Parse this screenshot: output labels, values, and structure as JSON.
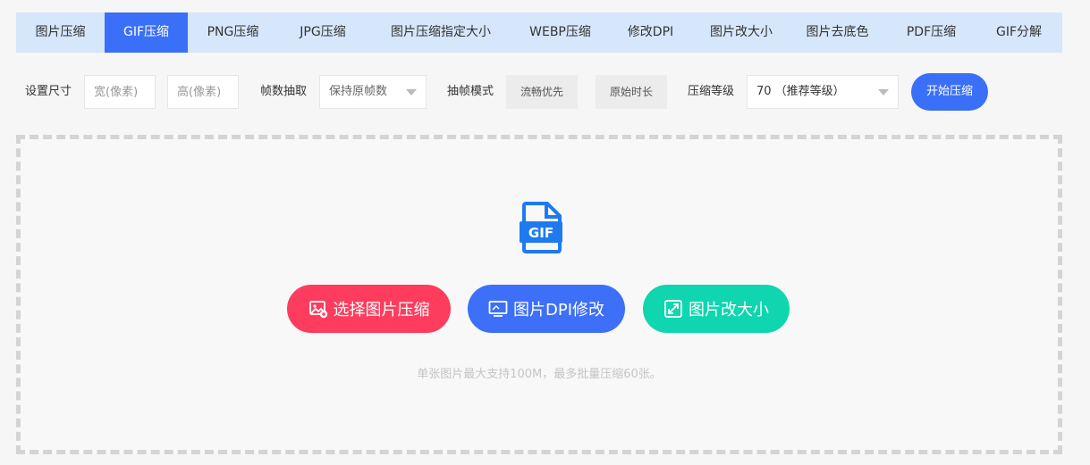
{
  "tabs": [
    {
      "label": "图片压缩",
      "active": false
    },
    {
      "label": "GIF压缩",
      "active": true
    },
    {
      "label": "PNG压缩",
      "active": false
    },
    {
      "label": "JPG压缩",
      "active": false
    },
    {
      "label": "图片压缩指定大小",
      "active": false
    },
    {
      "label": "WEBP压缩",
      "active": false
    },
    {
      "label": "修改DPI",
      "active": false
    },
    {
      "label": "图片改大小",
      "active": false
    },
    {
      "label": "图片去底色",
      "active": false
    },
    {
      "label": "PDF压缩",
      "active": false
    },
    {
      "label": "GIF分解",
      "active": false
    }
  ],
  "controls": {
    "size_label": "设置尺寸",
    "width_placeholder": "宽(像素)",
    "height_placeholder": "高(像素)",
    "frames_label": "帧数抽取",
    "frames_value": "保持原帧数",
    "mode_label": "抽帧模式",
    "mode_smooth": "流畅优先",
    "mode_original": "原始时长",
    "level_label": "压缩等级",
    "level_value": "70 （推荐等级）",
    "start_button": "开始压缩"
  },
  "dropzone": {
    "file_badge": "GIF",
    "select_button": "选择图片压缩",
    "dpi_button": "图片DPI修改",
    "resize_button": "图片改大小",
    "hint": "单张图片最大支持100M，最多批量压缩60张。"
  },
  "colors": {
    "accent": "#3a6ff7",
    "tab_bar": "#d6e6fb",
    "red": "#fe3c5d",
    "blue": "#3d6ff8",
    "green": "#0fd6ae"
  }
}
